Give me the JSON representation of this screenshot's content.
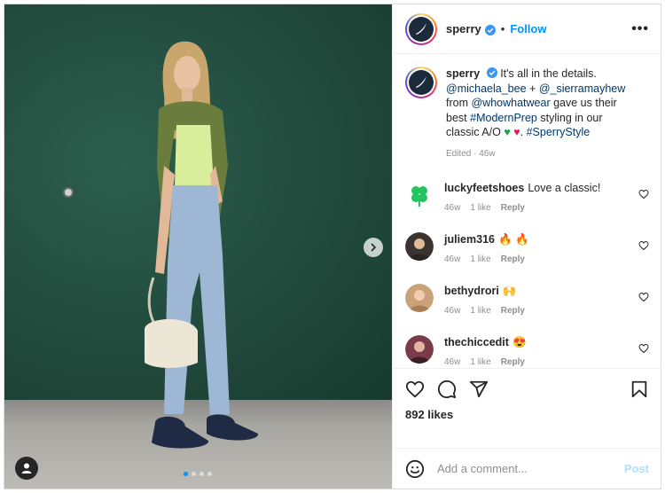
{
  "post": {
    "username": "sperry",
    "follow_label": "Follow",
    "bullet": "•",
    "more_label": "•••"
  },
  "caption": {
    "username": "sperry",
    "text_1": "It's all in the details.",
    "mention_1": "@michaela_bee",
    "plus": "+",
    "mention_2": "@_sierramayhew",
    "from": "from",
    "mention_3": "@whowhatwear",
    "text_2": "gave us their best",
    "hashtag_1": "#ModernPrep",
    "text_3": "styling in our classic A/O",
    "heart_green": "♥",
    "heart_red": "♥",
    "text_4": ".",
    "hashtag_2": "#SperryStyle",
    "meta": "Edited · 46w"
  },
  "comments": [
    {
      "username": "luckyfeetshoes",
      "text": "Love a classic!",
      "time": "46w",
      "likes": "1 like",
      "reply": "Reply",
      "avatar_color": "#22c55e"
    },
    {
      "username": "juliem316",
      "text": "🔥 🔥",
      "time": "46w",
      "likes": "1 like",
      "reply": "Reply",
      "avatar_color": "#6b5a4a"
    },
    {
      "username": "bethydrori",
      "text": "🙌",
      "time": "46w",
      "likes": "1 like",
      "reply": "Reply",
      "avatar_color": "#c9a27a"
    },
    {
      "username": "thechiccedit",
      "text": "😍",
      "time": "46w",
      "likes": "1 like",
      "reply": "Reply",
      "avatar_color": "#7a3b4a"
    }
  ],
  "likes_count": "892 likes",
  "add_comment": {
    "placeholder": "Add a comment...",
    "post_label": "Post"
  },
  "colors": {
    "accent": "#0095f6",
    "verified": "#3897f0",
    "brand_dark": "#1c2b3c"
  },
  "carousel": {
    "total_slides": 4,
    "active_index": 0
  }
}
